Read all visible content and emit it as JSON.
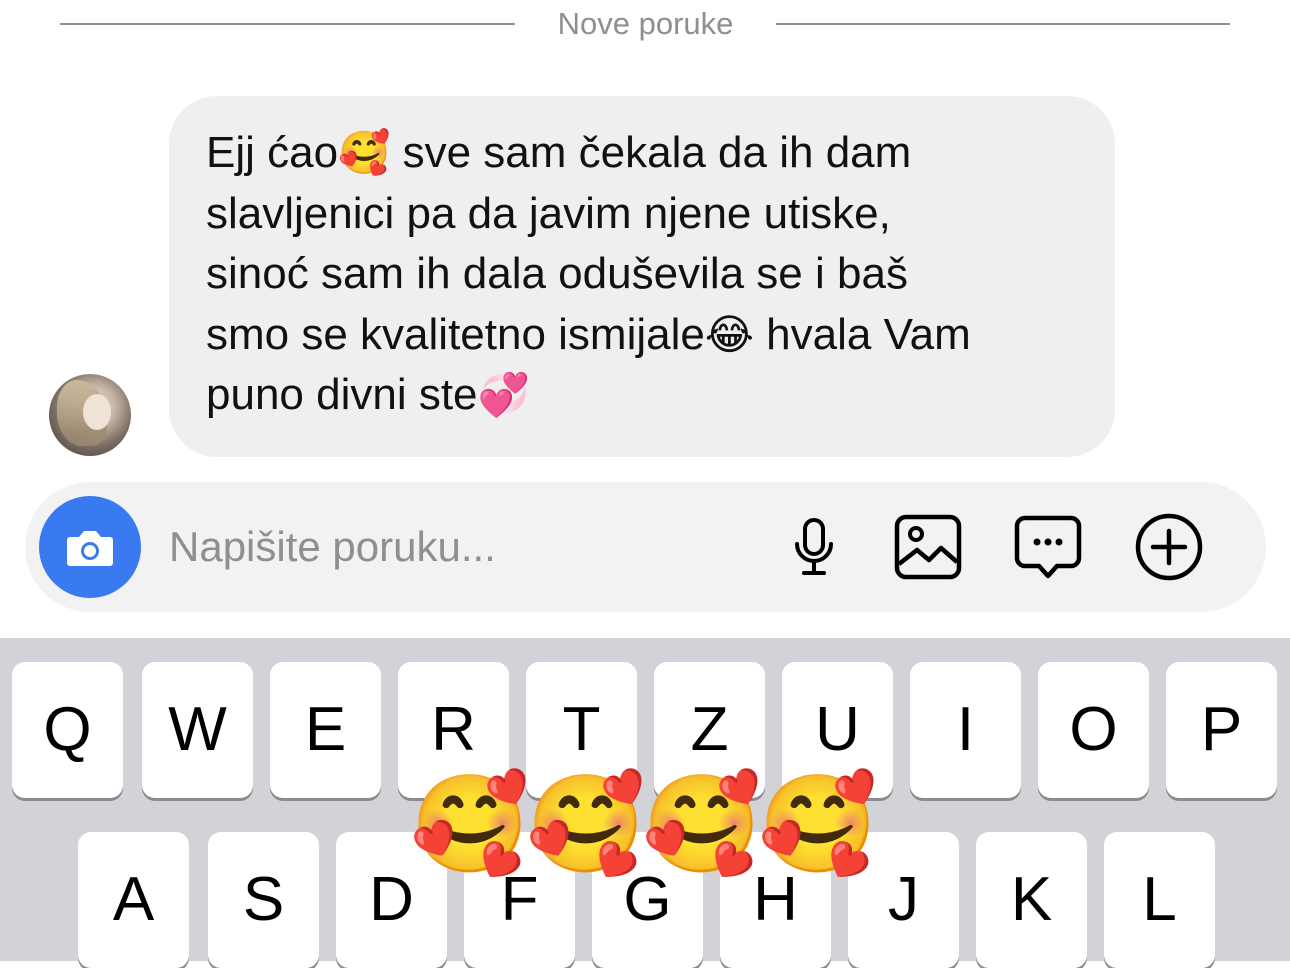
{
  "divider": {
    "label": "Nove poruke"
  },
  "message": {
    "lines": [
      [
        "Ejj ćao",
        "🥰",
        " sve sam čekala da ih dam"
      ],
      [
        "slavljenici pa da javim njene utiske,"
      ],
      [
        "sinoć sam ih dala oduševila se i baš"
      ],
      [
        "smo se kvalitetno ismijale",
        "😂",
        " hvala Vam"
      ],
      [
        "puno divni ste",
        "💞"
      ]
    ],
    "line1": {
      "a": "Ejj ćao",
      "emoji": "🥰",
      "b": " sve sam čekala da ih dam"
    },
    "line2": "slavljenici pa da javim njene utiske,",
    "line3": "sinoć sam ih dala oduševila se i baš",
    "line4": {
      "a": "smo se kvalitetno ismijale",
      "emoji": "😂",
      "b": " hvala Vam"
    },
    "line5": {
      "a": "puno divni ste",
      "emoji": "💞"
    }
  },
  "composer": {
    "placeholder": "Napišite poruku...",
    "camera_icon": "camera-icon",
    "mic_icon": "microphone-icon",
    "gallery_icon": "gallery-icon",
    "sticker_icon": "chat-bubble-icon",
    "plus_icon": "plus-circle-icon",
    "accent_color": "#3a7af0"
  },
  "keyboard": {
    "row1": [
      "Q",
      "W",
      "E",
      "R",
      "T",
      "Z",
      "U",
      "I",
      "O",
      "P"
    ],
    "row2": [
      "A",
      "S",
      "D",
      "F",
      "G",
      "H",
      "J",
      "K",
      "L"
    ]
  },
  "floating_emojis": [
    "🥰",
    "🥰",
    "🥰",
    "🥰"
  ]
}
